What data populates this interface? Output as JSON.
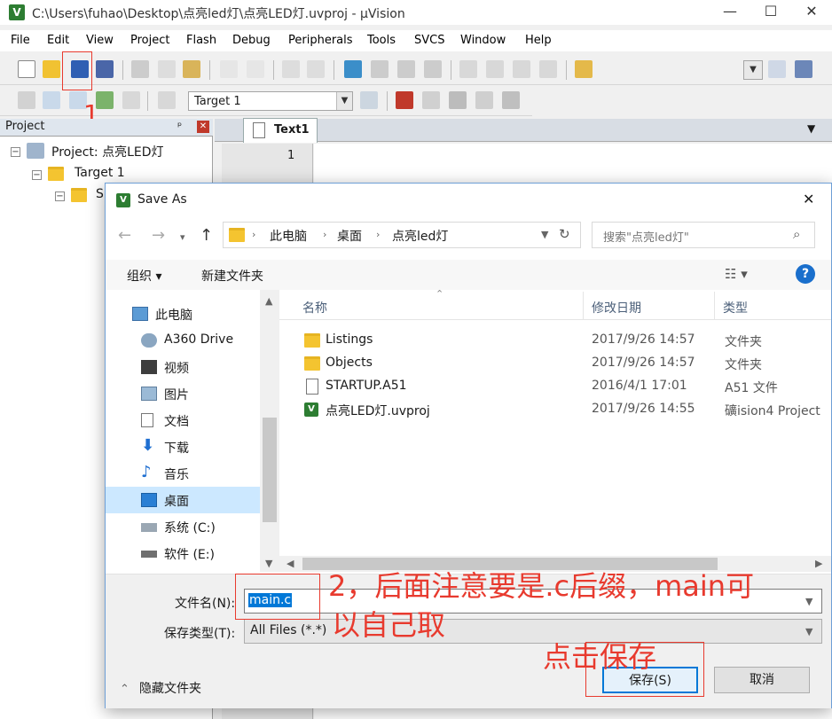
{
  "window": {
    "title": "C:\\Users\\fuhao\\Desktop\\点亮led灯\\点亮LED灯.uvproj - µVision",
    "app_icon_letter": "V",
    "minimize": "—",
    "maximize": "☐",
    "close": "✕"
  },
  "menu": [
    "File",
    "Edit",
    "View",
    "Project",
    "Flash",
    "Debug",
    "Peripherals",
    "Tools",
    "SVCS",
    "Window",
    "Help"
  ],
  "toolbar2": {
    "target_value": "Target 1"
  },
  "project_panel": {
    "title": "Project",
    "pin": "ᵖ",
    "close": "✕",
    "tree": {
      "root": "Project: 点亮LED灯",
      "target": "Target 1",
      "group_partial": "S"
    }
  },
  "editor": {
    "tab_label": "Text1",
    "line_number": "1",
    "tab_menu": "▼"
  },
  "dialog": {
    "title": "Save As",
    "close": "✕",
    "nav_back": "←",
    "nav_forward": "→",
    "nav_up": "↑",
    "breadcrumb": [
      "此电脑",
      "桌面",
      "点亮led灯"
    ],
    "search_placeholder": "搜索\"点亮led灯\"",
    "organize_label": "组织 ▾",
    "new_folder_label": "新建文件夹",
    "help": "?",
    "nav_items": [
      {
        "label": "此电脑",
        "icon": "computer-icon"
      },
      {
        "label": "A360 Drive",
        "icon": "cloud-drive-icon"
      },
      {
        "label": "视频",
        "icon": "video-icon"
      },
      {
        "label": "图片",
        "icon": "pictures-icon"
      },
      {
        "label": "文档",
        "icon": "documents-icon"
      },
      {
        "label": "下载",
        "icon": "download-icon"
      },
      {
        "label": "音乐",
        "icon": "music-icon"
      },
      {
        "label": "桌面",
        "icon": "desktop-icon"
      },
      {
        "label": "系统 (C:)",
        "icon": "drive-c-icon"
      },
      {
        "label": "软件 (E:)",
        "icon": "drive-e-icon"
      }
    ],
    "columns": {
      "name": "名称",
      "date": "修改日期",
      "type": "类型"
    },
    "files": [
      {
        "name": "Listings",
        "date": "2017/9/26 14:57",
        "type": "文件夹",
        "icon": "folder-icon"
      },
      {
        "name": "Objects",
        "date": "2017/9/26 14:57",
        "type": "文件夹",
        "icon": "folder-icon"
      },
      {
        "name": "STARTUP.A51",
        "date": "2016/4/1 17:01",
        "type": "A51 文件",
        "icon": "file-icon"
      },
      {
        "name": "点亮LED灯.uvproj",
        "date": "2017/9/26 14:55",
        "type": "礦ision4 Project",
        "icon": "uvision-project-icon"
      }
    ],
    "filename_label": "文件名(N):",
    "filename_value": "main.c",
    "filetype_label": "保存类型(T):",
    "filetype_value": "All Files (*.*)",
    "hide_folders": "隐藏文件夹",
    "save_button": "保存(S)",
    "cancel_button": "取消"
  },
  "annotations": {
    "step1": "1",
    "step2_line1": "2，后面注意要是.c后缀，main可",
    "step2_line2": "以自己取",
    "click_save": "点击保存",
    "color": "#e83a2e"
  }
}
